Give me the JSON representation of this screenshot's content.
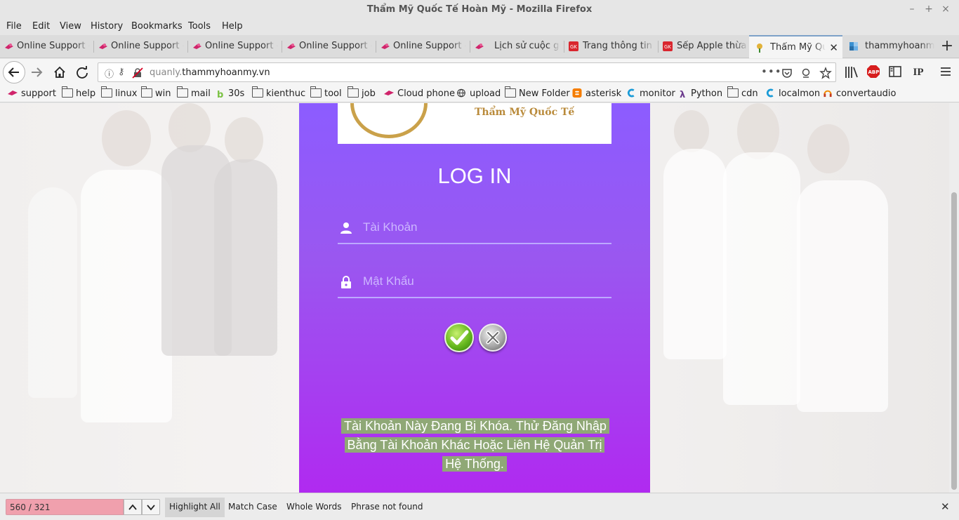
{
  "window": {
    "title": "Thẩm Mỹ Quốc Tế Hoàn Mỹ - Mozilla Firefox",
    "controls": [
      "–",
      "+",
      "×"
    ]
  },
  "menu": [
    "File",
    "Edit",
    "View",
    "History",
    "Bookmarks",
    "Tools",
    "Help"
  ],
  "tabs": [
    {
      "label": "Online Support -",
      "icon": "site-icon"
    },
    {
      "label": "Online Support -",
      "icon": "site-icon"
    },
    {
      "label": "Online Support -",
      "icon": "site-icon"
    },
    {
      "label": "Online Support -",
      "icon": "site-icon"
    },
    {
      "label": "Online Support -",
      "icon": "site-icon"
    },
    {
      "label": "Lịch sử cuộc gọ",
      "icon": "site-icon"
    },
    {
      "label": "Trang thông tin c",
      "icon": "news-icon"
    },
    {
      "label": "Sếp Apple thừa n",
      "icon": "news-icon"
    },
    {
      "label": "Thẩm Mỹ Quố",
      "icon": "flower-icon",
      "active": true
    },
    {
      "label": "thammyhoanmy",
      "icon": "puzzle-icon"
    }
  ],
  "url": {
    "prefix": "quanly.",
    "domain": "thammyhoanmy.vn"
  },
  "bookmarks": [
    {
      "label": "support",
      "icon": "site-icon"
    },
    {
      "label": "help",
      "icon": "folder-icon"
    },
    {
      "label": "linux",
      "icon": "folder-icon"
    },
    {
      "label": "win",
      "icon": "folder-icon"
    },
    {
      "label": "mail",
      "icon": "folder-icon"
    },
    {
      "label": "30s",
      "icon": "b-icon"
    },
    {
      "label": "kienthuc",
      "icon": "folder-icon"
    },
    {
      "label": "tool",
      "icon": "folder-icon"
    },
    {
      "label": "job",
      "icon": "folder-icon"
    },
    {
      "label": "Cloud phone",
      "icon": "site-icon"
    },
    {
      "label": "upload",
      "icon": "globe-icon"
    },
    {
      "label": "New Folder",
      "icon": "folder-icon"
    },
    {
      "label": "asterisk",
      "icon": "blogger-icon"
    },
    {
      "label": "monitor",
      "icon": "c-icon"
    },
    {
      "label": "Python",
      "icon": "lambda-icon"
    },
    {
      "label": "cdn",
      "icon": "folder-icon"
    },
    {
      "label": "localmon",
      "icon": "c-icon"
    },
    {
      "label": "convertaudio",
      "icon": "headphones-icon"
    }
  ],
  "page": {
    "logo_text": "Thẩm Mỹ Quốc Tế",
    "title": "LOG IN",
    "username_placeholder": "Tài Khoản",
    "password_placeholder": "Mật Khẩu",
    "message": "Tài Khoản Này Đang Bị Khóa. Thử Đăng Nhập Bằng Tài Khoản Khác Hoặc Liên Hệ Quản Trị Hệ Thống."
  },
  "findbar": {
    "value": "560 / 321",
    "highlight_all": "Highlight All",
    "match_case": "Match Case",
    "whole_words": "Whole Words",
    "status": "Phrase not found"
  },
  "colors": {
    "panel_top": "#8c5cff",
    "panel_bottom": "#b02af0",
    "message_highlight": "#8fa876",
    "find_not_found": "#f0a0ad"
  }
}
